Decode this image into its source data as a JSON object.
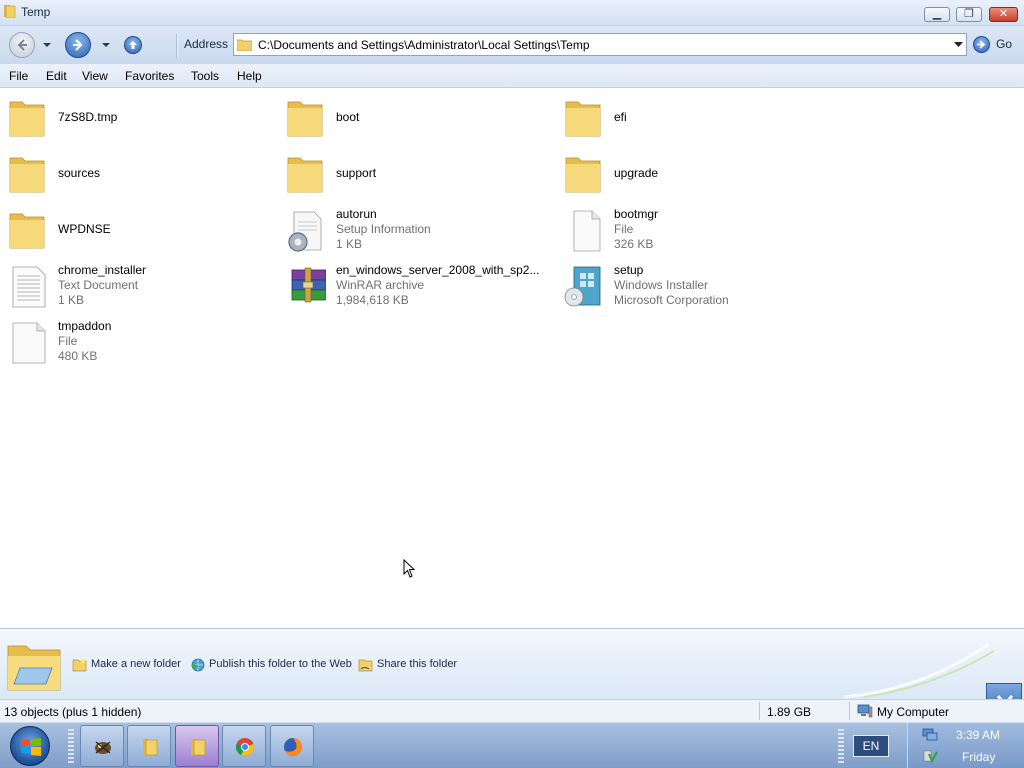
{
  "window": {
    "title": "Temp",
    "minimize_glyph": "▁",
    "maximize_glyph": "❐",
    "close_glyph": "✕"
  },
  "toolbar": {
    "address_label": "Address",
    "address_value": "C:\\Documents and Settings\\Administrator\\Local Settings\\Temp",
    "go_label": "Go"
  },
  "menu": {
    "items": [
      "File",
      "Edit",
      "View",
      "Favorites",
      "Tools",
      "Help"
    ]
  },
  "files": [
    {
      "name": "7zS8D.tmp",
      "type": "",
      "detail": "",
      "icon": "folder-icon"
    },
    {
      "name": "boot",
      "type": "",
      "detail": "",
      "icon": "folder-icon"
    },
    {
      "name": "efi",
      "type": "",
      "detail": "",
      "icon": "folder-icon"
    },
    {
      "name": "sources",
      "type": "",
      "detail": "",
      "icon": "folder-icon"
    },
    {
      "name": "support",
      "type": "",
      "detail": "",
      "icon": "folder-icon"
    },
    {
      "name": "upgrade",
      "type": "",
      "detail": "",
      "icon": "folder-icon"
    },
    {
      "name": "WPDNSE",
      "type": "",
      "detail": "",
      "icon": "folder-icon"
    },
    {
      "name": "autorun",
      "type": "Setup Information",
      "detail": "1 KB",
      "icon": "setup-info-icon"
    },
    {
      "name": "bootmgr",
      "type": "File",
      "detail": "326 KB",
      "icon": "blank-file-icon"
    },
    {
      "name": "chrome_installer",
      "type": "Text Document",
      "detail": "1 KB",
      "icon": "text-document-icon"
    },
    {
      "name": "en_windows_server_2008_with_sp2...",
      "type": "WinRAR archive",
      "detail": "1,984,618 KB",
      "icon": "winrar-archive-icon"
    },
    {
      "name": "setup",
      "type": "Windows Installer",
      "detail": "Microsoft Corporation",
      "icon": "windows-installer-icon"
    },
    {
      "name": "tmpaddon",
      "type": "File",
      "detail": "480 KB",
      "icon": "blank-file-icon"
    }
  ],
  "tasks": {
    "new_folder": "Make a new folder",
    "publish": "Publish this folder to the Web",
    "share": "Share this folder"
  },
  "status": {
    "objects": "13 objects (plus 1 hidden)",
    "size": "1.89 GB",
    "location": "My Computer"
  },
  "taskbar": {
    "language": "EN",
    "time": "3:39 AM",
    "day": "Friday"
  },
  "colors": {
    "folder_yellow": "#f2d16b",
    "titlebar_blue": "#d3e1f3",
    "taskbar_blue": "#8fabd4"
  }
}
